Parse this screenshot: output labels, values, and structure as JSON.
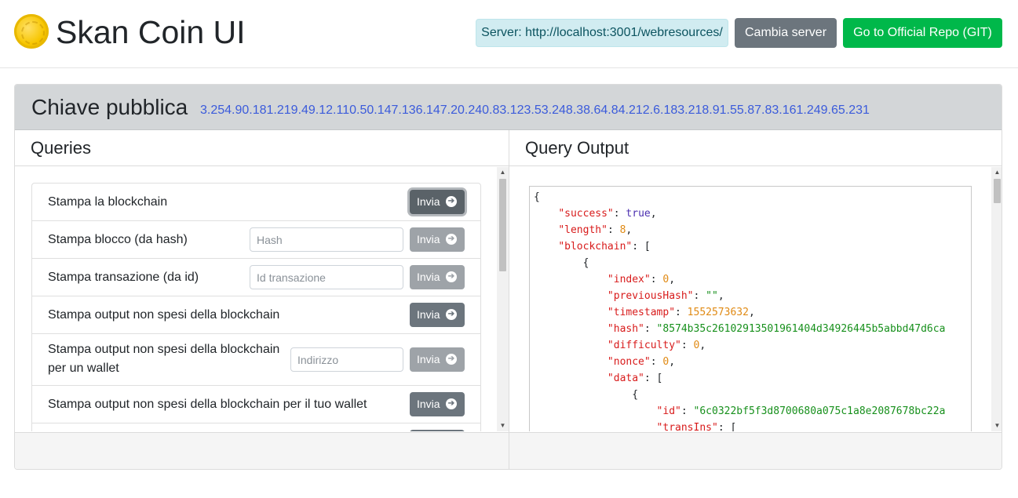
{
  "header": {
    "title": "Skan Coin UI",
    "server_label": "Server: http://localhost:3001/webresources/",
    "change_server": "Cambia server",
    "repo_button": "Go to Official Repo (GIT)"
  },
  "card": {
    "title": "Chiave pubblica",
    "public_key": "3.254.90.181.219.49.12.110.50.147.136.147.20.240.83.123.53.248.38.64.84.212.6.183.218.91.55.87.83.161.249.65.231"
  },
  "queries": {
    "title": "Queries",
    "send_label": "Invia",
    "items": [
      {
        "label": "Stampa la blockchain"
      },
      {
        "label": "Stampa blocco (da hash)",
        "placeholder": "Hash"
      },
      {
        "label": "Stampa transazione (da id)",
        "placeholder": "Id transazione"
      },
      {
        "label": "Stampa output non spesi della blockchain"
      },
      {
        "label_line1": "Stampa output non spesi della blockchain",
        "label_line2": "per un wallet",
        "placeholder": "Indirizzo"
      },
      {
        "label": "Stampa output non spesi della blockchain per il tuo wallet"
      }
    ]
  },
  "output": {
    "title": "Query Output",
    "lines": [
      {
        "indent": "",
        "key": "",
        "value": "",
        "text": "{"
      },
      {
        "indent": "    ",
        "key": "\"success\"",
        "value": "true",
        "vtype": "b",
        "tail": ","
      },
      {
        "indent": "    ",
        "key": "\"length\"",
        "value": "8",
        "vtype": "n",
        "tail": ","
      },
      {
        "indent": "    ",
        "key": "\"blockchain\"",
        "value": "[",
        "vtype": "p",
        "tail": ""
      },
      {
        "indent": "        ",
        "key": "",
        "value": "",
        "text": "{"
      },
      {
        "indent": "            ",
        "key": "\"index\"",
        "value": "0",
        "vtype": "n",
        "tail": ","
      },
      {
        "indent": "            ",
        "key": "\"previousHash\"",
        "value": "\"\"",
        "vtype": "s",
        "tail": ","
      },
      {
        "indent": "            ",
        "key": "\"timestamp\"",
        "value": "1552573632",
        "vtype": "n",
        "tail": ","
      },
      {
        "indent": "            ",
        "key": "\"hash\"",
        "value": "\"8574b35c26102913501961404d34926445b5abbd47d6ca",
        "vtype": "s",
        "tail": ""
      },
      {
        "indent": "            ",
        "key": "\"difficulty\"",
        "value": "0",
        "vtype": "n",
        "tail": ","
      },
      {
        "indent": "            ",
        "key": "\"nonce\"",
        "value": "0",
        "vtype": "n",
        "tail": ","
      },
      {
        "indent": "            ",
        "key": "\"data\"",
        "value": "[",
        "vtype": "p",
        "tail": ""
      },
      {
        "indent": "                ",
        "key": "",
        "value": "",
        "text": "{"
      },
      {
        "indent": "                    ",
        "key": "\"id\"",
        "value": "\"6c0322bf5f3d8700680a075c1a8e2087678bc22a",
        "vtype": "s",
        "tail": ""
      },
      {
        "indent": "                    ",
        "key": "\"transIns\"",
        "value": "[",
        "vtype": "p",
        "tail": ""
      }
    ]
  }
}
